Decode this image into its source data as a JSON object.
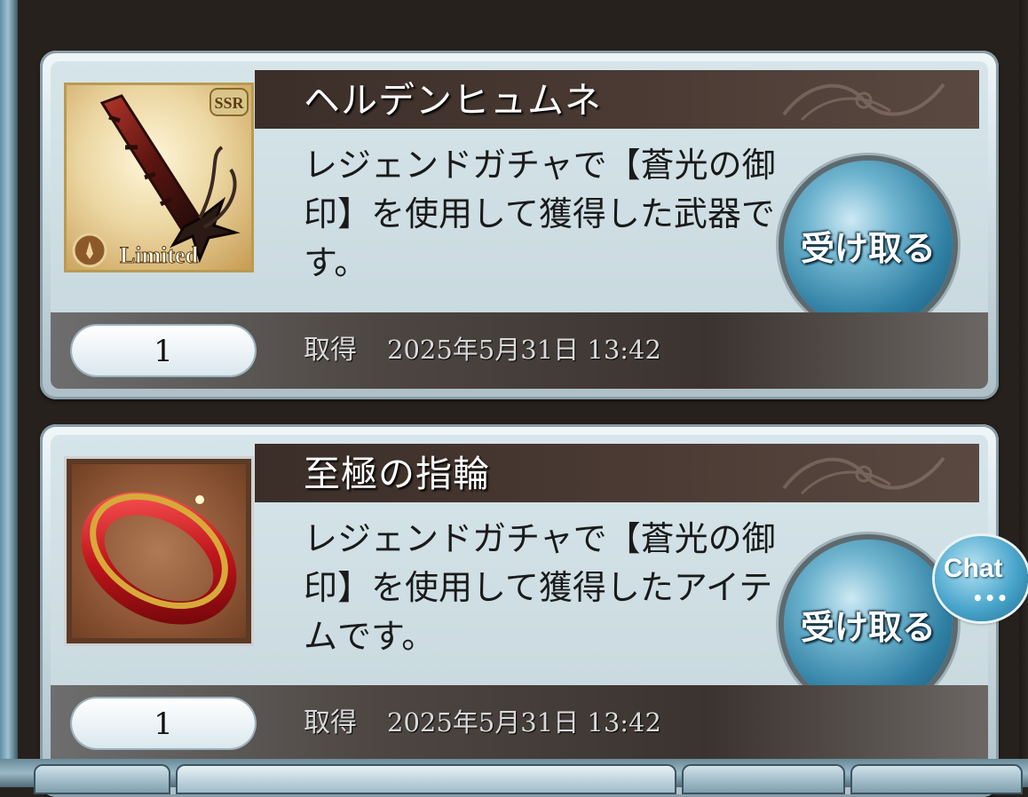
{
  "items": [
    {
      "name": "ヘルデンヒュムネ",
      "description": "レジェンドガチャで【蒼光の御印】を使用して獲得した武器です。",
      "quantity": "1",
      "acquired_label": "取得",
      "acquired_date": "2025年5月31日 13:42",
      "claim_label": "受け取る",
      "thumbnail": {
        "icon": "weapon-icon",
        "rarity_badge": "SSR",
        "banner": "Limited"
      }
    },
    {
      "name": "至極の指輪",
      "description": "レジェンドガチャで【蒼光の御印】を使用して獲得したアイテムです。",
      "quantity": "1",
      "acquired_label": "取得",
      "acquired_date": "2025年5月31日 13:42",
      "claim_label": "受け取る",
      "thumbnail": {
        "icon": "ring-icon"
      }
    }
  ],
  "chat": {
    "label": "Chat",
    "dots": "•••"
  },
  "colors": {
    "title_band": "#3b2e28",
    "claim_button": "#2f7fa3",
    "card_frame": "#c5d6dc"
  }
}
